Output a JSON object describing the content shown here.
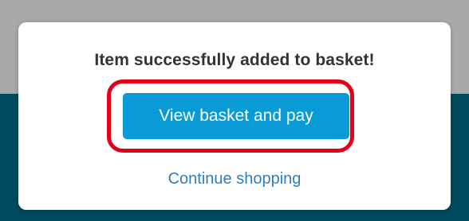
{
  "dialog": {
    "title": "Item successfully added to basket!",
    "primary_button_label": "View basket and pay",
    "secondary_link_label": "Continue shopping"
  },
  "colors": {
    "primary_button": "#0a9bd6",
    "highlight_ring": "#e4001b",
    "link": "#2f7dc0",
    "backdrop_band": "#004a5e"
  }
}
